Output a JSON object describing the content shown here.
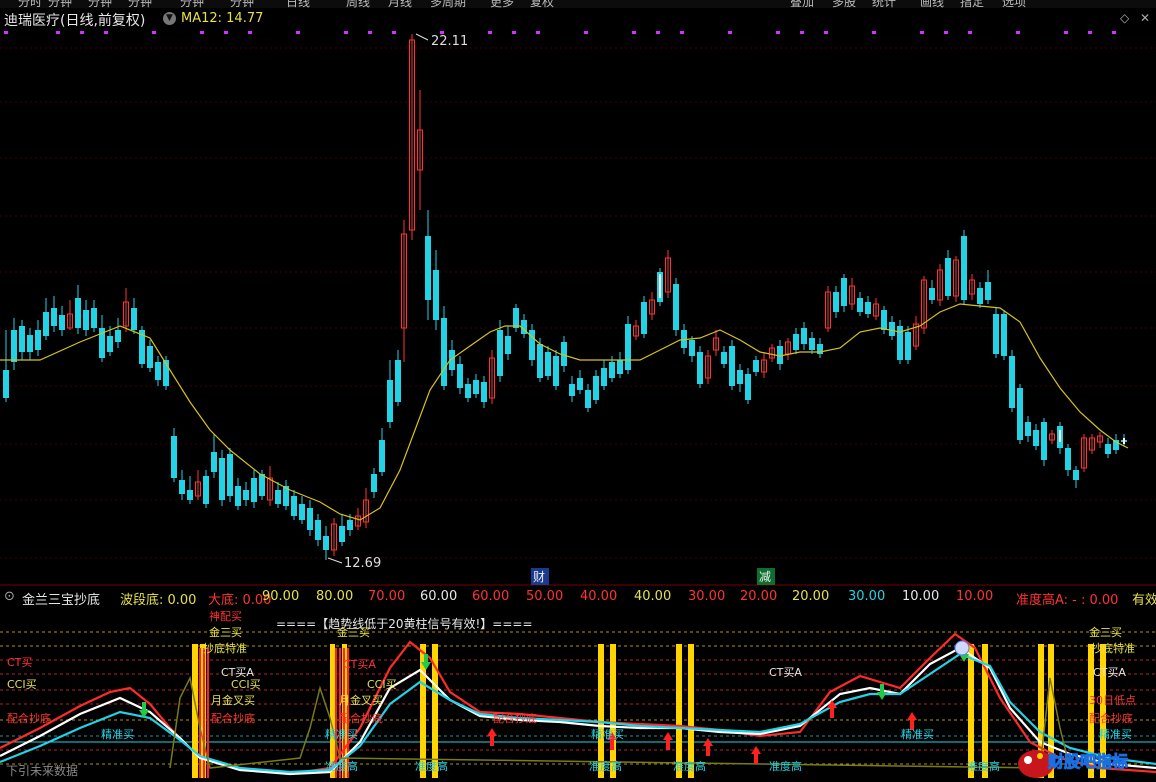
{
  "topbar": {
    "tabs": [
      "分时",
      "分钟",
      "分钟",
      "分钟",
      "分钟",
      "分钟",
      "日线",
      "周线",
      "月线",
      "多周期",
      "更多",
      "复权",
      "叠加",
      "多股",
      "统计",
      "画线",
      "指定",
      "选项"
    ]
  },
  "header": {
    "title": "迪瑞医疗(日线,前复权)",
    "ma_label": "MA12: 14.77"
  },
  "main_chart": {
    "high_label": "22.11",
    "low_label": "12.69",
    "event_caihui": "财",
    "event_jian": "减",
    "colors": {
      "up": "#ff3333",
      "down": "#22d3e6",
      "ma": "#d8c21a"
    }
  },
  "sub_header": {
    "indicator": "金兰三宝抄底",
    "items": [
      {
        "label": "波段底:",
        "value": "0.00",
        "color": "#e6e04a"
      },
      {
        "label": "大底:",
        "value": "0.00",
        "color": "#ff3333"
      },
      {
        "label": "",
        "value": "90.00",
        "color": "#e6e04a"
      },
      {
        "label": "",
        "value": "80.00",
        "color": "#e6e04a"
      },
      {
        "label": "",
        "value": "70.00",
        "color": "#ff3333"
      },
      {
        "label": "",
        "value": "60.00",
        "color": "#e6e6e6"
      },
      {
        "label": "",
        "value": "60.00",
        "color": "#ff3333"
      },
      {
        "label": "",
        "value": "50.00",
        "color": "#ff3333"
      },
      {
        "label": "",
        "value": "40.00",
        "color": "#ff3333"
      },
      {
        "label": "",
        "value": "40.00",
        "color": "#e6e04a"
      },
      {
        "label": "",
        "value": "30.00",
        "color": "#ff3333"
      },
      {
        "label": "",
        "value": "20.00",
        "color": "#ff3333"
      },
      {
        "label": "",
        "value": "20.00",
        "color": "#e6e04a"
      },
      {
        "label": "",
        "value": "30.00",
        "color": "#22d3e6"
      },
      {
        "label": "",
        "value": "10.00",
        "color": "#e6e6e6"
      },
      {
        "label": "",
        "value": "10.00",
        "color": "#ff3333"
      },
      {
        "label": "准度高A:",
        "value": "- : 0.00",
        "color": "#ff3333"
      },
      {
        "label": "有效",
        "value": "",
        "color": "#e6e04a"
      }
    ]
  },
  "sub_chart": {
    "banner": "====【趋势线低于20黄柱信号有效!】====",
    "labels": {
      "ct_buy": "CT买",
      "cci_buy": "CCI买",
      "match_bottom": "配合抄底",
      "precise_buy": "精准买",
      "gold_three": "金三买",
      "bottom_special": "抄底特准",
      "ct_buy_a": "CT买A",
      "month_gold_cross": "月金叉买",
      "shenpei_buy": "神配买",
      "high_accuracy": "准度高",
      "future_data": "下引未来数据",
      "day30_low": "30日低点"
    },
    "watermark": "财股吧指标"
  }
}
